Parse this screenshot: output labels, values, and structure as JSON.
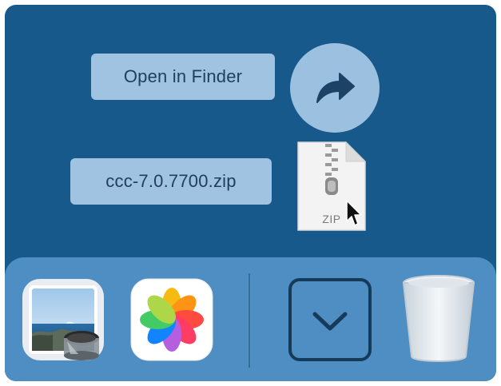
{
  "drag_hud": {
    "open_label": "Open in Finder",
    "file_name": "ccc-7.0.7700.zip",
    "file_type_label": "ZIP",
    "open_icon": "share-arrow-icon",
    "file_icon": "zip-file-icon",
    "cursor_icon": "cursor-icon"
  },
  "dock": {
    "items": [
      {
        "name": "Preview",
        "icon": "preview-icon"
      },
      {
        "name": "Photos",
        "icon": "photos-icon"
      },
      {
        "name": "Downloads",
        "icon": "downloads-chevron-icon"
      },
      {
        "name": "Trash",
        "icon": "trash-icon"
      }
    ]
  },
  "colors": {
    "desktop_bg": "#17598a",
    "dock_bg": "#4e8ec2",
    "pill_bg": "#9fc3e1",
    "pill_text": "#1f3f5c"
  }
}
